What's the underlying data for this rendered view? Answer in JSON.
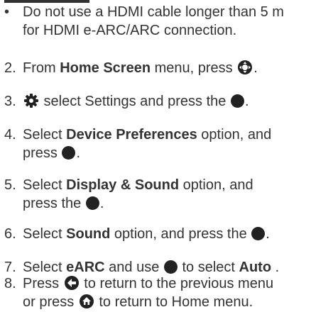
{
  "note": {
    "bullet": "•",
    "line1": "Do not use a HDMI cable longer than 5 m",
    "line2": "for HDMI e-ARC/ARC connection."
  },
  "steps": {
    "s2": {
      "num": "2.",
      "a": "From ",
      "b": "Home Screen",
      "c": " menu, press ",
      "d": "."
    },
    "s3": {
      "num": "3.",
      "a": " select Settings and press the ",
      "b": "."
    },
    "s4": {
      "num": "4.",
      "a": "Select ",
      "b": "Device Preferences",
      "c": " option, and",
      "d": "press ",
      "e": "."
    },
    "s5": {
      "num": "5.",
      "a": "Select ",
      "b": "Display & Sound",
      "c": " option, and",
      "d": "press the ",
      "e": "."
    },
    "s6": {
      "num": "6.",
      "a": "Select ",
      "b": "Sound",
      "c": " option, and press the ",
      "d": "."
    },
    "s7": {
      "num": "7.",
      "a": "Select ",
      "b": "eARC",
      "c": " and use ",
      "d": " to select ",
      "e": "Auto",
      "f": " ."
    },
    "s8": {
      "num": "8.",
      "a": "Press ",
      "b": " to return to the previous menu",
      "c": "or press ",
      "d": " to return to Home menu."
    }
  },
  "icons": [
    "dpad-icon",
    "gear-icon",
    "ok-button-icon",
    "back-arrow-icon",
    "home-icon"
  ]
}
